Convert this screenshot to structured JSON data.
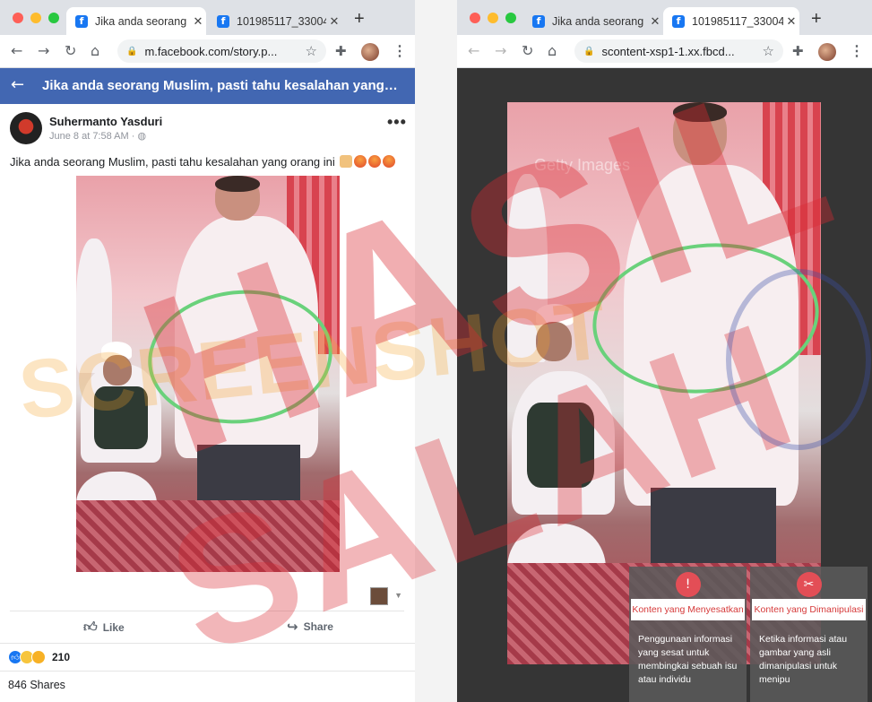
{
  "left_window": {
    "tabs": [
      {
        "title": "Jika anda seorang",
        "close": "✕"
      },
      {
        "title": "101985117_33004",
        "close": "✕"
      }
    ],
    "new_tab": "+",
    "url": "m.facebook.com/story.p...",
    "fb_header_title": "Jika anda seorang Muslim, pasti tahu kesalahan yang…",
    "post": {
      "author": "Suhermanto Yasduri",
      "meta": "June 8 at 7:58 AM · ",
      "text": "Jika anda seorang Muslim, pasti tahu kesalahan yang orang ini",
      "more": "•••"
    },
    "actions": {
      "like": "Like",
      "share": "Share"
    },
    "reaction_count": "210",
    "shares": "846 Shares"
  },
  "right_window": {
    "tabs": [
      {
        "title": "Jika anda seorang",
        "close": "✕"
      },
      {
        "title": "101985117_33004",
        "close": "✕"
      }
    ],
    "new_tab": "+",
    "url": "scontent-xsp1-1.xx.fbcd...",
    "labels": [
      {
        "title": "Konten yang Menyesatkan",
        "desc": "Penggunaan informasi yang sesat untuk membingkai sebuah isu atau individu"
      },
      {
        "title": "Konten yang Dimanipulasi",
        "desc": "Ketika informasi atau gambar yang asli dimanipulasi untuk menipu"
      }
    ]
  },
  "stamps": {
    "main": "HASIL",
    "secondary": "SALAH",
    "watermark": "SCREENSHOT",
    "stock": "Getty Images"
  },
  "colors": {
    "fb_blue": "#4267b2",
    "stamp_red": "#d92a32",
    "highlight_circle": "#6ad17b"
  }
}
